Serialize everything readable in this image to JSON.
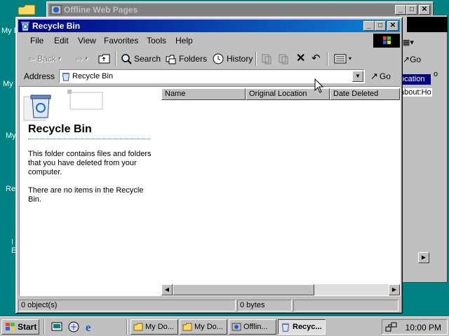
{
  "desktop": {
    "labels": [
      "My D",
      "My",
      "My",
      "Re",
      "I",
      "E"
    ]
  },
  "back_window": {
    "title": "Offline Web Pages",
    "right_go": "Go",
    "right_location": "ocation",
    "right_link": "about:Ho",
    "right_edge": "o"
  },
  "window": {
    "title": "Recycle Bin",
    "menu": [
      "File",
      "Edit",
      "View",
      "Favorites",
      "Tools",
      "Help"
    ],
    "toolbar": {
      "back": "Back",
      "search": "Search",
      "folders": "Folders",
      "history": "History"
    },
    "address": {
      "label": "Address",
      "value": "Recycle Bin",
      "go": "Go"
    },
    "left_pane": {
      "title": "Recycle Bin",
      "description": "This folder contains files and folders that you have deleted from your computer.",
      "empty_note": "There are no items in the Recycle Bin."
    },
    "columns": [
      "Name",
      "Original Location",
      "Date Deleted"
    ],
    "status": {
      "objects": "0 object(s)",
      "size": "0 bytes"
    }
  },
  "taskbar": {
    "start": "Start",
    "tasks": [
      "My Do...",
      "My Do...",
      "Offlin...",
      "Recyc..."
    ],
    "clock": "10:00 PM"
  }
}
